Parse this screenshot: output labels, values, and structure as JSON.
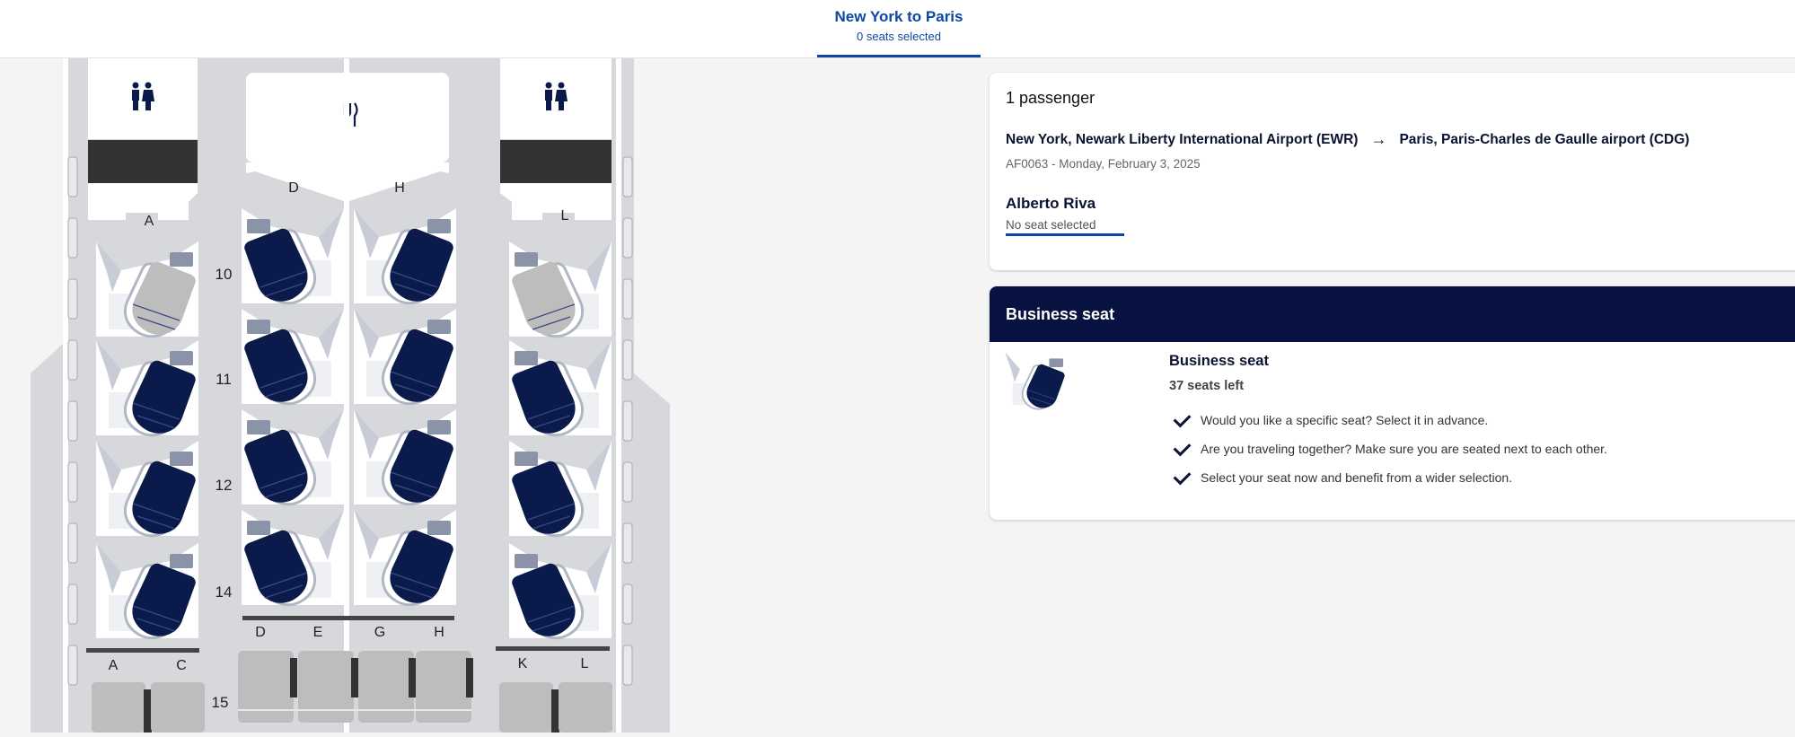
{
  "header": {
    "title": "New York to Paris",
    "subtitle": "0 seats selected"
  },
  "seatmap": {
    "rows": [
      "10",
      "11",
      "12",
      "14",
      "15"
    ],
    "top_letters": {
      "a": "A",
      "d": "D",
      "h": "H",
      "l": "L"
    },
    "bottom_letters": {
      "a": "A",
      "c": "C",
      "d": "D",
      "e": "E",
      "g": "G",
      "h": "H",
      "k": "K",
      "l": "L"
    },
    "icons": [
      "lavatory-icon",
      "galley-icon",
      "lavatory-icon"
    ],
    "colors": {
      "available_seat": "#0a1a4a",
      "unavailable_seat": "#bfbfbf",
      "cabin": "#d6d8dc"
    }
  },
  "passenger_card": {
    "count": "1 passenger",
    "origin": "New York, Newark Liberty International Airport (EWR)",
    "destination": "Paris, Paris-Charles de Gaulle airport (CDG)",
    "flight": "AF0063 - Monday, February 3, 2025",
    "name": "Alberto Riva",
    "seat_status": "No seat selected"
  },
  "business_card": {
    "header": "Business seat",
    "title": "Business seat",
    "seats_left": "37 seats left",
    "features": [
      "Would you like a specific seat? Select it in advance.",
      "Are you traveling together? Make sure you are seated next to each other.",
      "Select your seat now and benefit from a wider selection."
    ]
  },
  "colors": {
    "brand": "#0d47a1",
    "navy": "#071240"
  }
}
